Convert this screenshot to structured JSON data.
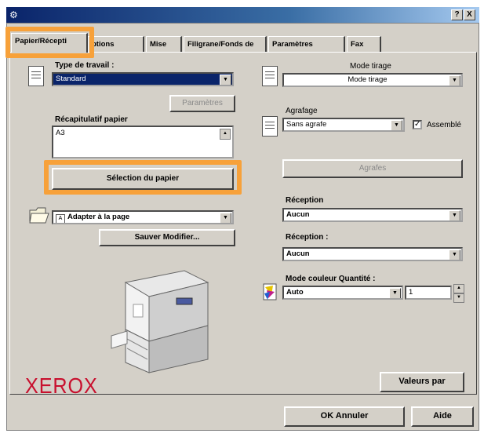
{
  "window": {
    "title": "",
    "help_label": "?",
    "close_label": "X"
  },
  "tabs": [
    {
      "label": "Papier/Récepti"
    },
    {
      "label": "ptions"
    },
    {
      "label": "Mise"
    },
    {
      "label": "Filigrane/Fonds de"
    },
    {
      "label": "Paramètres"
    },
    {
      "label": "Fax"
    }
  ],
  "left": {
    "job_type_label": "Type de travail :",
    "job_type_value": "Standard",
    "parameters_button": "Paramètres",
    "paper_summary_label": "Récapitulatif papier",
    "paper_summary_value": "A3",
    "paper_selection_button": "Sélection du papier",
    "fit_value": "Adapter à la page",
    "save_modify_button": "Sauver Modifier...",
    "logo_text": "XEROX"
  },
  "right": {
    "mode_label": "Mode tirage",
    "mode_value": "Mode tirage",
    "stapling_label": "Agrafage",
    "stapling_value": "Sans agrafe",
    "collated_label": "Assemblé",
    "collated_checked": true,
    "staples_button": "Agrafes",
    "reception1_label": "Réception",
    "reception1_value": "Aucun",
    "reception2_label": "Réception :",
    "reception2_value": "Aucun",
    "color_qty_label": "Mode couleur Quantité :",
    "color_value": "Auto",
    "quantity_value": "1",
    "defaults_button": "Valeurs par"
  },
  "footer": {
    "ok_cancel_button": "OK Annuler",
    "help_button": "Aide"
  },
  "colors": {
    "highlight": "#f7a13a",
    "dialog": "#d4d0c8",
    "selection": "#0a246a",
    "logo": "#c8102e"
  }
}
